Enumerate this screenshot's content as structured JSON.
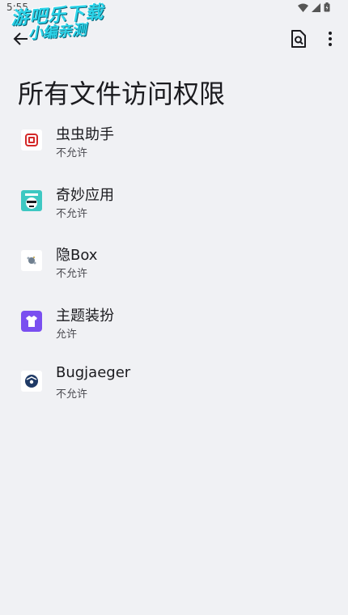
{
  "status_bar": {
    "time": "5:55"
  },
  "watermark": {
    "line1": "游吧乐下载",
    "line2": "小编亲测"
  },
  "page": {
    "title": "所有文件访问权限"
  },
  "apps": [
    {
      "name": "虫虫助手",
      "status": "不允许",
      "icon": "chongchong-icon"
    },
    {
      "name": "奇妙应用",
      "status": "不允许",
      "icon": "magic-icon"
    },
    {
      "name": "隐Box",
      "status": "不允许",
      "icon": "yinbox-icon"
    },
    {
      "name": "主题装扮",
      "status": "允许",
      "icon": "theme-icon"
    },
    {
      "name": "Bugjaeger",
      "status": "不允许",
      "icon": "bugjaeger-icon"
    }
  ]
}
